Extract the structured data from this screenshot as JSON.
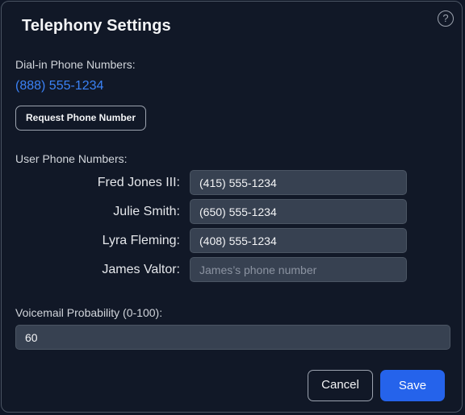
{
  "dialog": {
    "title": "Telephony Settings",
    "help_icon": "?"
  },
  "dial_in": {
    "label": "Dial-in Phone Numbers:",
    "number": "(888) 555-1234",
    "request_button": "Request Phone Number"
  },
  "user_numbers": {
    "label": "User Phone Numbers:",
    "users": [
      {
        "name": "Fred Jones III:",
        "value": "(415) 555-1234",
        "placeholder": ""
      },
      {
        "name": "Julie Smith:",
        "value": "(650) 555-1234",
        "placeholder": ""
      },
      {
        "name": "Lyra Fleming:",
        "value": "(408) 555-1234",
        "placeholder": ""
      },
      {
        "name": "James Valtor:",
        "value": "",
        "placeholder": "James’s phone number"
      }
    ]
  },
  "voicemail": {
    "label": "Voicemail Probability (0-100):",
    "value": "60"
  },
  "footer": {
    "cancel_label": "Cancel",
    "save_label": "Save"
  },
  "colors": {
    "accent": "#2563eb",
    "link": "#3b82f6",
    "background": "#111827"
  },
  "icons": [
    "question-circle-icon"
  ]
}
